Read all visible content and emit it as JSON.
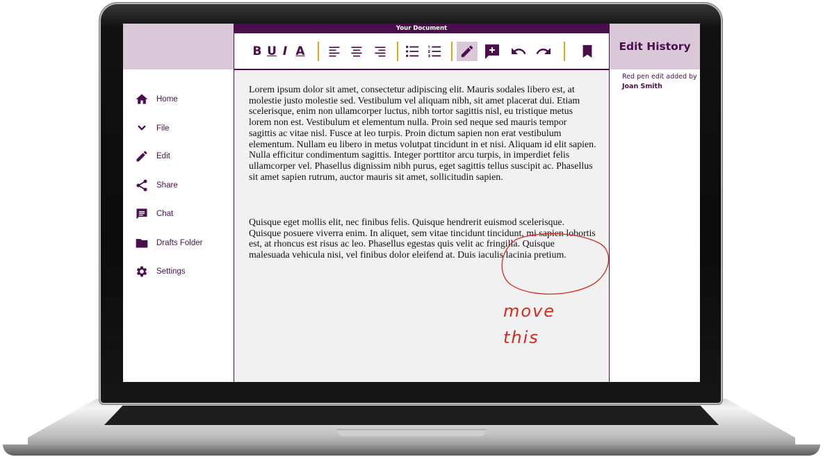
{
  "window": {
    "title": "Your Document"
  },
  "sidebar": {
    "items": [
      {
        "label": "Home",
        "icon": "home-icon"
      },
      {
        "label": "File",
        "icon": "chevron-down-icon"
      },
      {
        "label": "Edit",
        "icon": "pencil-icon"
      },
      {
        "label": "Share",
        "icon": "share-icon"
      },
      {
        "label": "Chat",
        "icon": "chat-icon"
      },
      {
        "label": "Drafts Folder",
        "icon": "folder-icon"
      },
      {
        "label": "Settings",
        "icon": "gear-icon"
      }
    ]
  },
  "toolbar": {
    "bold": "B",
    "underline": "U",
    "italic": "I",
    "text_color": "A",
    "buttons": [
      "align-left-icon",
      "align-center-icon",
      "align-right-icon",
      "bullet-list-icon",
      "numbered-list-icon",
      "pen-icon",
      "add-comment-icon",
      "undo-icon",
      "redo-icon",
      "bookmark-icon"
    ],
    "active_tool": "pen-icon"
  },
  "document": {
    "paragraphs": [
      "Lorem ipsum dolor sit amet, consectetur adipiscing elit. Mauris sodales libero est, at molestie justo molestie sed. Vestibulum vel aliquam nibh, sit amet placerat dui. Etiam scelerisque, enim non ullamcorper luctus, nibh tortor sagittis nisl, eu tristique metus lorem non est. Vestibulum et elementum nulla. Proin sed neque sed mauris tempor sagittis ac vitae nisl. Fusce at leo turpis. Proin dictum sapien non erat vestibulum elementum. Nullam eu libero in metus volutpat tincidunt in et nisi. Aliquam id elit sapien. Nulla efficitur condimentum sagittis. Integer porttitor arcu turpis, in imperdiet felis ullamcorper vel. Phasellus dignissim nibh purus, eget sagittis tellus suscipit ac. Phasellus sit amet sapien rutrum, auctor mauris sit amet, sollicitudin sapien.",
      "Quisque eget mollis elit, nec finibus felis. Quisque hendrerit euismod scelerisque. Quisque posuere viverra enim. In aliquet, sem vitae tincidunt tincidunt, mi sapien lobortis est, at rhoncus est risus ac leo. Phasellus egestas quis velit ac fringilla. Quisque malesuada vehicula nisi, vel finibus dolor eleifend at. Duis iaculis lacinia pretium."
    ],
    "handwritten_note": [
      "move",
      "this"
    ]
  },
  "history": {
    "title": "Edit History",
    "entry_text": "Red pen edit added by",
    "entry_author": "Joan Smith"
  },
  "colors": {
    "brand": "#4a0e4e",
    "panel": "#d8c8d8",
    "separator": "#e8a317",
    "pen": "#d42a1e",
    "doc_bg": "#f1f1f1"
  }
}
